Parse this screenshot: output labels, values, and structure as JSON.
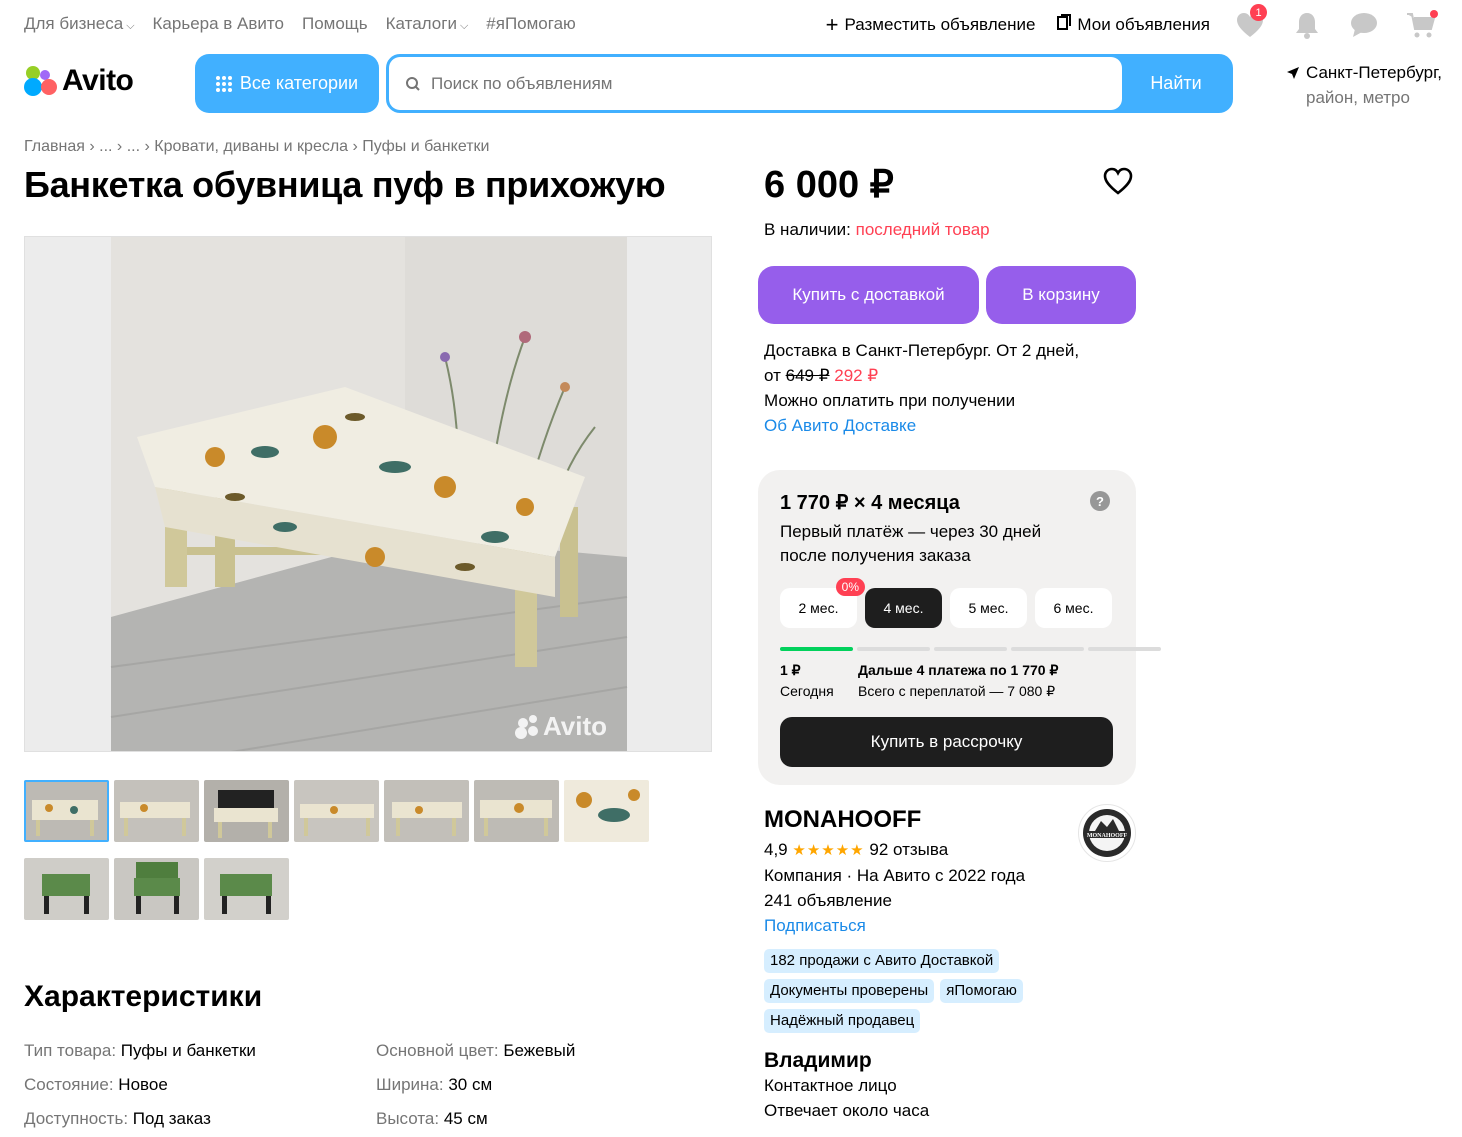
{
  "topnav": {
    "items": [
      "Для бизнеса",
      "Карьера в Авито",
      "Помощь",
      "Каталоги",
      "#яПомогаю"
    ],
    "post_ad": "Разместить объявление",
    "my_ads": "Мои объявления",
    "favorites_count": "1"
  },
  "header": {
    "logo_text": "Avito",
    "categories_label": "Все категории",
    "search_placeholder": "Поиск по объявлениям",
    "search_button": "Найти",
    "city": "Санкт-Петербург,",
    "city_sub": "район, метро"
  },
  "breadcrumbs": [
    "Главная",
    "...",
    "...",
    "Кровати, диваны и кресла",
    "Пуфы и банкетки"
  ],
  "title": "Банкетка обувница пуф в прихожую",
  "gallery": {
    "watermark": "Avito"
  },
  "characteristics": {
    "heading": "Характеристики",
    "left": [
      {
        "k": "Тип товара:",
        "v": "Пуфы и банкетки"
      },
      {
        "k": "Состояние:",
        "v": "Новое"
      },
      {
        "k": "Доступность:",
        "v": "Под заказ"
      }
    ],
    "right": [
      {
        "k": "Основной цвет:",
        "v": "Бежевый"
      },
      {
        "k": "Ширина:",
        "v": "30 см"
      },
      {
        "k": "Высота:",
        "v": "45 см"
      }
    ]
  },
  "offer": {
    "price": "6 000 ₽",
    "stock_label": "В наличии:",
    "stock_value": "последний товар",
    "buy_delivery": "Купить с доставкой",
    "to_cart": "В корзину",
    "delivery_line1": "Доставка в Санкт-Петербург. От 2 дней,",
    "delivery_from": "от",
    "delivery_old": "649 ₽",
    "delivery_new": "292 ₽",
    "pay_on_receipt": "Можно оплатить при получении",
    "about_delivery": "Об Авито Доставке"
  },
  "installment": {
    "heading": "1 770 ₽ × 4 месяца",
    "help": "?",
    "subtitle": "Первый платёж — через 30 дней после получения заказа",
    "months": [
      "2 мес.",
      "4 мес.",
      "5 мес.",
      "6 мес."
    ],
    "zero_badge": "0%",
    "first_amount": "1 ₽",
    "first_label": "Сегодня",
    "next_label": "Дальше 4 платежа по 1 770 ₽",
    "total_label": "Всего с переплатой — 7 080 ₽",
    "buy_button": "Купить в рассрочку"
  },
  "seller": {
    "name": "MONAHOOFF",
    "rating": "4,9",
    "stars": "★★★★★",
    "reviews": "92 отзыва",
    "type": "Компания · На Авито с 2022 года",
    "ads_count": "241 объявление",
    "subscribe": "Подписаться",
    "logo_text": "MONAHOOFF",
    "tags": [
      "182 продажи с Авито Доставкой",
      "Документы проверены",
      "яПомогаю",
      "Надёжный продавец"
    ]
  },
  "contact": {
    "name": "Владимир",
    "role": "Контактное лицо",
    "response": "Отвечает около часа"
  },
  "colors": {
    "blue": "#41b0ff",
    "purple": "#965eeb",
    "red": "#ff4053",
    "link": "#1a8ae8"
  }
}
